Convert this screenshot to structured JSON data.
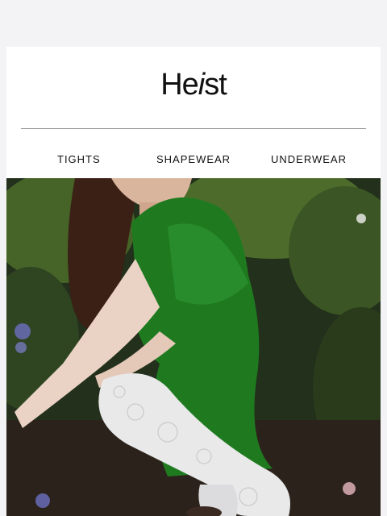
{
  "brand": {
    "logo_prefix": "He",
    "logo_italic": "i",
    "logo_suffix": "st"
  },
  "nav": {
    "items": [
      {
        "label": "TIGHTS"
      },
      {
        "label": "SHAPEWEAR"
      },
      {
        "label": "UNDERWEAR"
      }
    ]
  },
  "colors": {
    "background": "#f3f3f5",
    "card": "#ffffff",
    "dress_green": "#1f7a1f",
    "foliage": "#3d5a24"
  }
}
